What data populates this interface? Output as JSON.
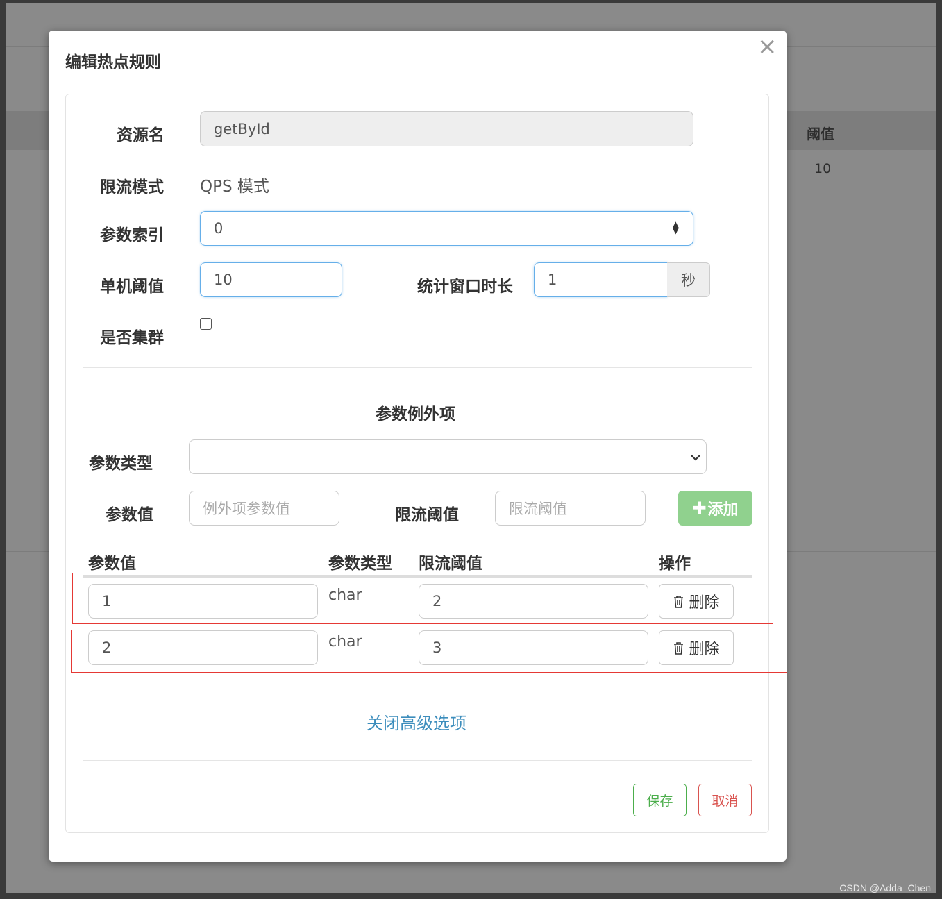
{
  "background": {
    "column_header": "阈值",
    "cell_value": "10"
  },
  "watermark": "CSDN @Adda_Chen",
  "modal": {
    "title": "编辑热点规则",
    "close": "×"
  },
  "form": {
    "resource_label": "资源名",
    "resource_value": "getById",
    "mode_label": "限流模式",
    "mode_value": "QPS 模式",
    "param_index_label": "参数索引",
    "param_index_value": "0",
    "threshold_label": "单机阈值",
    "threshold_value": "10",
    "window_label": "统计窗口时长",
    "window_value": "1",
    "window_unit": "秒",
    "cluster_label": "是否集群",
    "cluster_checked": false
  },
  "exceptions": {
    "section_title": "参数例外项",
    "type_label": "参数类型",
    "type_selected": "",
    "value_label": "参数值",
    "value_placeholder": "例外项参数值",
    "limit_label": "限流阈值",
    "limit_placeholder": "限流阈值",
    "add_button": "添加",
    "add_icon": "plus-icon",
    "table_headers": [
      "参数值",
      "参数类型",
      "限流阈值",
      "操作"
    ],
    "rows": [
      {
        "value": "1",
        "type": "char",
        "limit": "2",
        "action": "删除"
      },
      {
        "value": "2",
        "type": "char",
        "limit": "3",
        "action": "删除"
      }
    ],
    "delete_icon": "trash-icon"
  },
  "advanced_link": "关闭高级选项",
  "footer": {
    "save": "保存",
    "cancel": "取消"
  },
  "colors": {
    "accent": "#66afe9",
    "add_button": "#90d18e",
    "save": "#4cae4c",
    "cancel": "#d9534f",
    "highlight_box": "#e53935",
    "link": "#3c8dbc"
  }
}
